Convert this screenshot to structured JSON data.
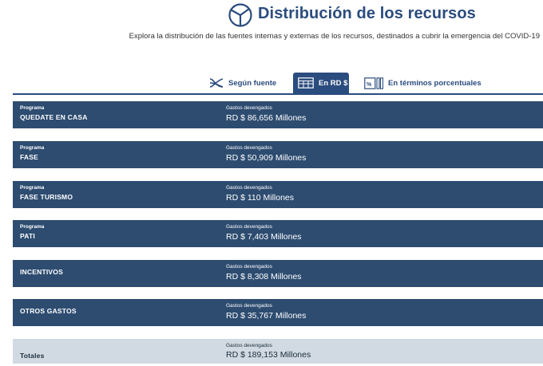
{
  "header": {
    "title": "Distribución de los recursos",
    "logo_icon": "pie-chart-icon",
    "subtitle": "Explora la distribución de las fuentes internas y externas de los recursos, destinados a cubrir la emergencia del COVID-19"
  },
  "tabs": [
    {
      "label": "Según fuente",
      "icon": "flow-icon",
      "active": false
    },
    {
      "label": "En RD $",
      "icon": "table-icon",
      "active": true
    },
    {
      "label": "En términos porcentuales",
      "icon": "percent-icon",
      "active": false
    }
  ],
  "rows": [
    {
      "small_label": "Programa",
      "name": "QUEDATE EN CASA",
      "gasto_label": "Gastos devengados",
      "value": "RD $ 86,656 Millones"
    },
    {
      "small_label": "Programa",
      "name": "FASE",
      "gasto_label": "Gastos devengados",
      "value": "RD $ 50,909 Millones"
    },
    {
      "small_label": "Programa",
      "name": "FASE TURISMO",
      "gasto_label": "Gastos devengados",
      "value": "RD $ 110 Millones"
    },
    {
      "small_label": "Programa",
      "name": "PATI",
      "gasto_label": "Gastos devengados",
      "value": "RD $ 7,403 Millones"
    },
    {
      "name": "INCENTIVOS",
      "gasto_label": "Gastos devengados",
      "value": "RD $ 8,308 Millones"
    },
    {
      "name": "OTROS GASTOS",
      "gasto_label": "Gastos devengados",
      "value": "RD $ 35,767 Millones"
    }
  ],
  "total": {
    "name": "Totales",
    "gasto_label": "Gastos devengados",
    "value": "RD $ 189,153 Millones"
  },
  "colors": {
    "primary": "#2b4c7e",
    "row_bg": "#2d4c70",
    "total_bg": "#d1dae2"
  }
}
